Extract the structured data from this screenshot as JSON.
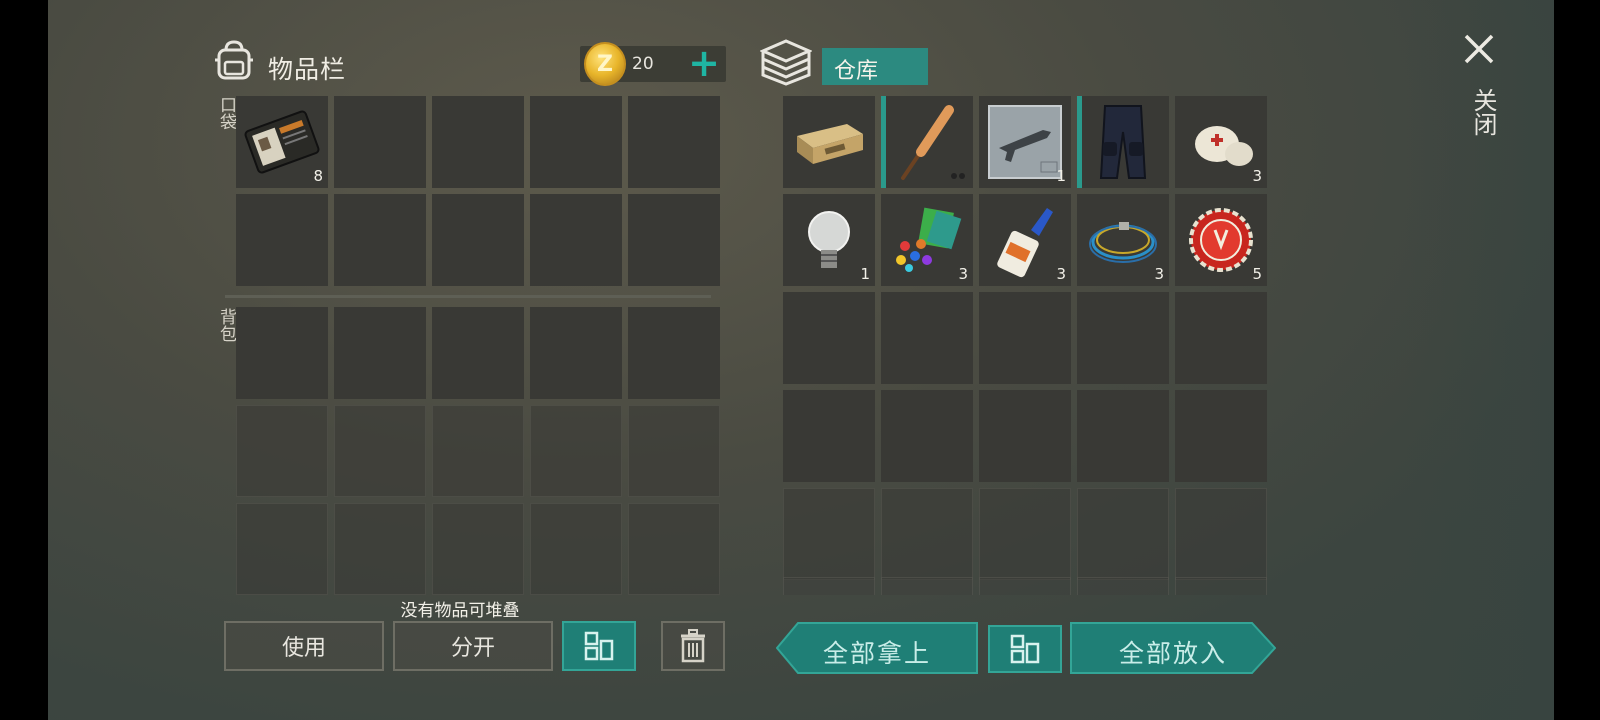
{
  "inventory": {
    "title": "物品栏"
  },
  "currency": {
    "value": "20"
  },
  "storage": {
    "tab_label": "仓库"
  },
  "sections": {
    "pocket": "口袋",
    "backpack": "背包"
  },
  "pocket_items": [
    {
      "name": "wallet-item",
      "count": "8"
    }
  ],
  "storage_items": [
    {
      "name": "ammo-crate-item",
      "count": ""
    },
    {
      "name": "baseball-bat-item",
      "count": ""
    },
    {
      "name": "rifle-blueprint-item",
      "count": "1"
    },
    {
      "name": "pants-item",
      "count": ""
    },
    {
      "name": "bandage-item",
      "count": "3"
    },
    {
      "name": "light-bulb-item",
      "count": "1"
    },
    {
      "name": "parts-item",
      "count": "3"
    },
    {
      "name": "glue-item",
      "count": "3"
    },
    {
      "name": "wire-item",
      "count": "3"
    },
    {
      "name": "bottle-cap-item",
      "count": "5"
    }
  ],
  "messages": {
    "no_stack": "没有物品可堆叠"
  },
  "buttons": {
    "use": "使用",
    "split": "分开",
    "take_all": "全部拿上",
    "put_all": "全部放入",
    "close": "关闭"
  },
  "colors": {
    "accent": "#2c8a80",
    "teal_plus": "#1fb5a3",
    "coin": "#e8b52a"
  }
}
